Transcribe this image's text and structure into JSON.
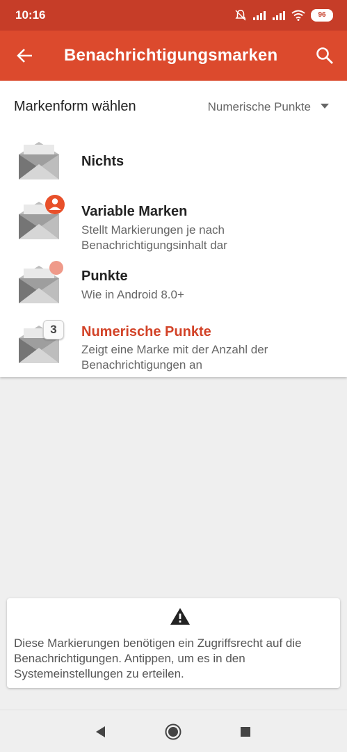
{
  "status": {
    "time": "10:16",
    "battery": "96"
  },
  "appbar": {
    "title": "Benachrichtigungsmarken"
  },
  "selector": {
    "label": "Markenform wählen",
    "value": "Numerische Punkte"
  },
  "options": [
    {
      "title": "Nichts",
      "subtitle": ""
    },
    {
      "title": "Variable Marken",
      "subtitle": "Stellt Markierungen je nach Benachrichtigungsinhalt dar"
    },
    {
      "title": "Punkte",
      "subtitle": "Wie in Android 8.0+"
    },
    {
      "title": "Numerische Punkte",
      "subtitle": "Zeigt eine Marke mit der Anzahl der Benachrichtigungen an",
      "badge_number": "3"
    }
  ],
  "notice": {
    "message": "Diese Markierungen benötigen ein Zugriffsrecht auf die Benachrichtigungen. Antippen, um es in den Systemeinstellungen zu erteilen."
  },
  "colors": {
    "status_bar": "#c63d28",
    "app_bar": "#dc4a2d",
    "accent": "#d24227",
    "badge_person": "#e8502a",
    "badge_dot": "#ef9a8a"
  },
  "icons": [
    "arrow-left-icon",
    "search-icon",
    "envelope-icon",
    "person-badge-icon",
    "dot-badge-icon",
    "number-badge-icon",
    "warning-icon",
    "nav-back-icon",
    "nav-home-icon",
    "nav-recents-icon"
  ]
}
